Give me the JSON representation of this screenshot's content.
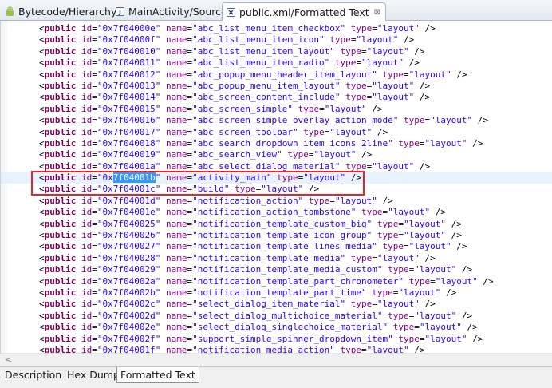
{
  "editor_tabs": [
    {
      "label": "Bytecode/Hierarchy",
      "icon": "android-icon",
      "active": false
    },
    {
      "label": "MainActivity/Source",
      "icon": "source-file-icon",
      "active": false
    },
    {
      "label": "public.xml/Formatted Text",
      "icon": "xml-file-icon",
      "active": true,
      "close": "⊠"
    }
  ],
  "code_lines": [
    {
      "id": "0x7f04000e",
      "name": "abc_list_menu_item_checkbox",
      "type": "layout"
    },
    {
      "id": "0x7f04000f",
      "name": "abc_list_menu_item_icon",
      "type": "layout"
    },
    {
      "id": "0x7f040010",
      "name": "abc_list_menu_item_layout",
      "type": "layout"
    },
    {
      "id": "0x7f040011",
      "name": "abc_list_menu_item_radio",
      "type": "layout"
    },
    {
      "id": "0x7f040012",
      "name": "abc_popup_menu_header_item_layout",
      "type": "layout"
    },
    {
      "id": "0x7f040013",
      "name": "abc_popup_menu_item_layout",
      "type": "layout"
    },
    {
      "id": "0x7f040014",
      "name": "abc_screen_content_include",
      "type": "layout"
    },
    {
      "id": "0x7f040015",
      "name": "abc_screen_simple",
      "type": "layout"
    },
    {
      "id": "0x7f040016",
      "name": "abc_screen_simple_overlay_action_mode",
      "type": "layout"
    },
    {
      "id": "0x7f040017",
      "name": "abc_screen_toolbar",
      "type": "layout"
    },
    {
      "id": "0x7f040018",
      "name": "abc_search_dropdown_item_icons_2line",
      "type": "layout"
    },
    {
      "id": "0x7f040019",
      "name": "abc_search_view",
      "type": "layout"
    },
    {
      "id": "0x7f04001a",
      "name": "abc_select_dialog_material",
      "type": "layout"
    },
    {
      "id": "0x7f04001b",
      "name": "activity_main",
      "type": "layout",
      "current": true,
      "selected": "7f04001b"
    },
    {
      "id": "0x7f04001c",
      "name": "build",
      "type": "layout"
    },
    {
      "id": "0x7f04001d",
      "name": "notification_action",
      "type": "layout"
    },
    {
      "id": "0x7f04001e",
      "name": "notification_action_tombstone",
      "type": "layout"
    },
    {
      "id": "0x7f040025",
      "name": "notification_template_custom_big",
      "type": "layout"
    },
    {
      "id": "0x7f040026",
      "name": "notification_template_icon_group",
      "type": "layout"
    },
    {
      "id": "0x7f040027",
      "name": "notification_template_lines_media",
      "type": "layout"
    },
    {
      "id": "0x7f040028",
      "name": "notification_template_media",
      "type": "layout"
    },
    {
      "id": "0x7f040029",
      "name": "notification_template_media_custom",
      "type": "layout"
    },
    {
      "id": "0x7f04002a",
      "name": "notification_template_part_chronometer",
      "type": "layout"
    },
    {
      "id": "0x7f04002b",
      "name": "notification_template_part_time",
      "type": "layout"
    },
    {
      "id": "0x7f04002c",
      "name": "select_dialog_item_material",
      "type": "layout"
    },
    {
      "id": "0x7f04002d",
      "name": "select_dialog_multichoice_material",
      "type": "layout"
    },
    {
      "id": "0x7f04002e",
      "name": "select_dialog_singlechoice_material",
      "type": "layout"
    },
    {
      "id": "0x7f04002f",
      "name": "support_simple_spinner_dropdown_item",
      "type": "layout"
    },
    {
      "id": "0x7f04001f",
      "name": "notification_media_action",
      "type": "layout"
    }
  ],
  "syntax": {
    "open": "<",
    "tag": "public",
    "id_attr": "id",
    "name_attr": "name",
    "type_attr": "type",
    "close": " />"
  },
  "scrollbar": {
    "left_arrow": "<"
  },
  "page_tabs": [
    {
      "label": "Description",
      "active": false
    },
    {
      "label": "Hex Dump",
      "active": false
    },
    {
      "label": "Formatted Text",
      "active": true
    }
  ],
  "colors": {
    "keyword": "#7f0055",
    "attribute": "#7f007f",
    "string": "#2a00ff",
    "selection": "#3399ff",
    "annotation_box": "#e8232a"
  }
}
